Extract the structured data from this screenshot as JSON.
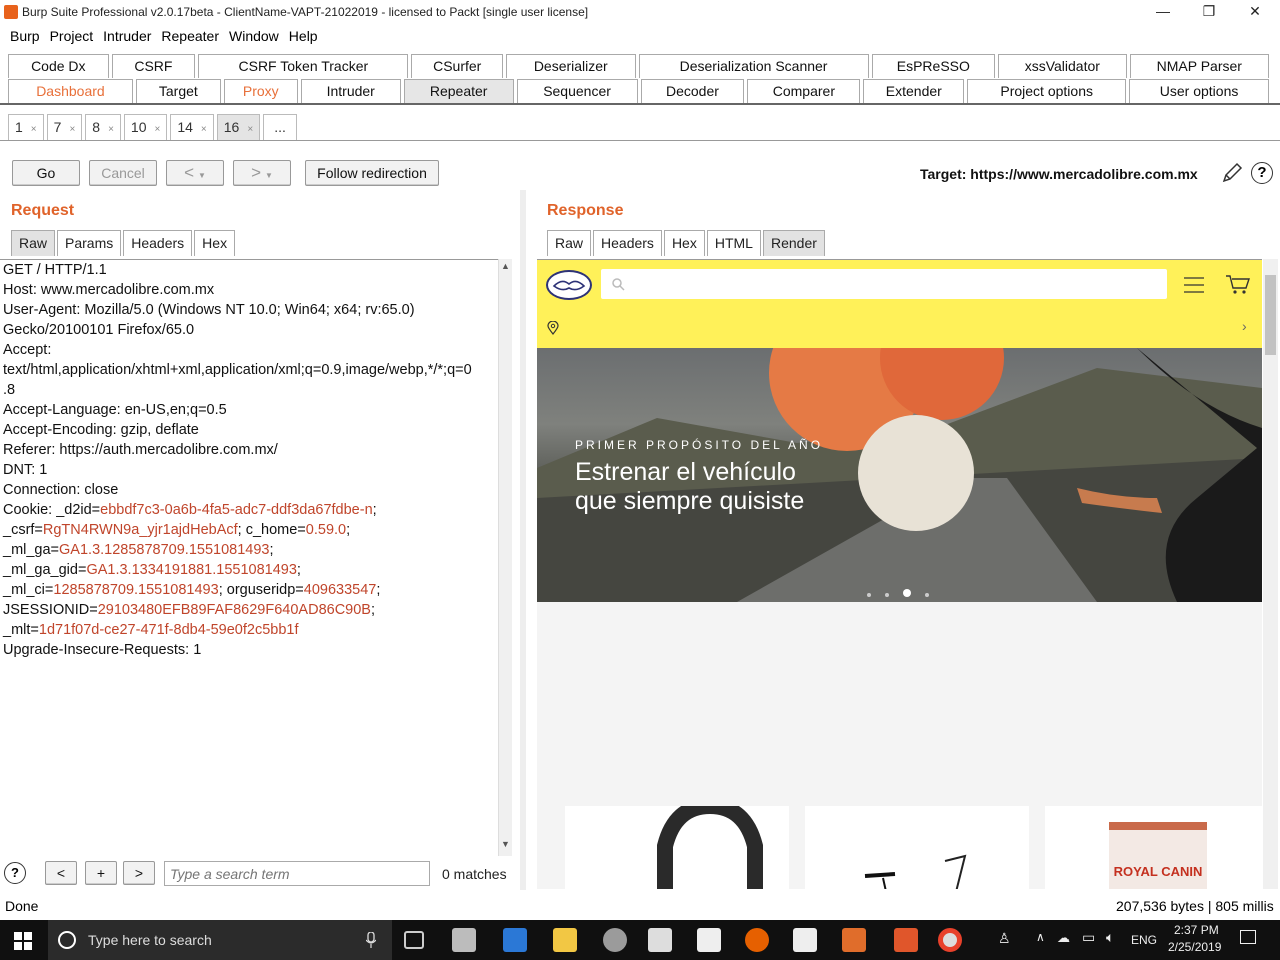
{
  "window": {
    "title": "Burp Suite Professional v2.0.17beta - ClientName-VAPT-21022019 - licensed to Packt [single user license]",
    "controls": {
      "minimize": "—",
      "maximize": "❐",
      "close": "✕"
    }
  },
  "menu": [
    "Burp",
    "Project",
    "Intruder",
    "Repeater",
    "Window",
    "Help"
  ],
  "tabs_row1": [
    "Code Dx",
    "CSRF",
    "CSRF Token Tracker",
    "CSurfer",
    "Deserializer",
    "Deserialization Scanner",
    "EsPReSSO",
    "xssValidator",
    "NMAP Parser"
  ],
  "tabs_row2": [
    "Dashboard",
    "Target",
    "Proxy",
    "Intruder",
    "Repeater",
    "Sequencer",
    "Decoder",
    "Comparer",
    "Extender",
    "Project options",
    "User options"
  ],
  "repeater_tabs": [
    "1",
    "7",
    "8",
    "10",
    "14",
    "16",
    "..."
  ],
  "tab_close": "×",
  "toolbar": {
    "go": "Go",
    "cancel": "Cancel",
    "back": "<",
    "forward": ">",
    "dropdown": "▼",
    "follow": "Follow redirection",
    "target_label": "Target: https://www.mercadolibre.com.mx",
    "help": "?"
  },
  "request": {
    "title": "Request",
    "tabs": [
      "Raw",
      "Params",
      "Headers",
      "Hex"
    ],
    "lines": [
      "GET / HTTP/1.1",
      "Host: www.mercadolibre.com.mx",
      "User-Agent: Mozilla/5.0 (Windows NT 10.0; Win64; x64; rv:65.0)",
      "Gecko/20100101 Firefox/65.0",
      "Accept:",
      "text/html,application/xhtml+xml,application/xml;q=0.9,image/webp,*/*;q=0",
      ".8",
      "Accept-Language: en-US,en;q=0.5",
      "Accept-Encoding: gzip, deflate",
      "Referer: https://auth.mercadolibre.com.mx/",
      "DNT: 1",
      "Connection: close"
    ],
    "cookie_lines": [
      {
        "k": "Cookie: _d2id=",
        "v": "ebbdf7c3-0a6b-4fa5-adc7-ddf3da67fdbe-n",
        "t": ";"
      },
      {
        "k": "_csrf=",
        "v": "RgTN4RWN9a_yjr1ajdHebAcf",
        "t": "; c_home=",
        "v2": "0.59.0",
        "t2": ";"
      },
      {
        "k": "_ml_ga=",
        "v": "GA1.3.1285878709.1551081493",
        "t": ";"
      },
      {
        "k": "_ml_ga_gid=",
        "v": "GA1.3.1334191881.1551081493",
        "t": ";"
      },
      {
        "k": "_ml_ci=",
        "v": "1285878709.1551081493",
        "t": "; orguseridp=",
        "v2": "409633547",
        "t2": ";"
      },
      {
        "k": "JSESSIONID=",
        "v": "29103480EFB89FAF8629F640AD86C90B",
        "t": ";"
      },
      {
        "k": "_mlt=",
        "v": "1d71f07d-ce27-471f-8db4-59e0f2c5bb1f",
        "t": ""
      }
    ],
    "last_line": "Upgrade-Insecure-Requests: 1"
  },
  "search": {
    "help": "?",
    "prev": "<",
    "add": "+",
    "next": ">",
    "placeholder": "Type a search term",
    "matches": "0 matches"
  },
  "response": {
    "title": "Response",
    "tabs": [
      "Raw",
      "Headers",
      "Hex",
      "HTML",
      "Render"
    ],
    "hero_kicker": "PRIMER PROPÓSITO DEL AÑO",
    "hero_line1": "Estrenar el vehículo",
    "hero_line2": "que siempre quisiste",
    "card3_brand": "ROYAL CANIN"
  },
  "status": {
    "left": "Done",
    "right": "207,536 bytes | 805 millis"
  },
  "taskbar": {
    "search_placeholder": "Type here to search",
    "lang": "ENG",
    "time": "2:37 PM",
    "date": "2/25/2019"
  },
  "colors": {
    "accent_orange": "#e0632a",
    "ml_yellow": "#fff159",
    "value_red": "#c0452b"
  }
}
